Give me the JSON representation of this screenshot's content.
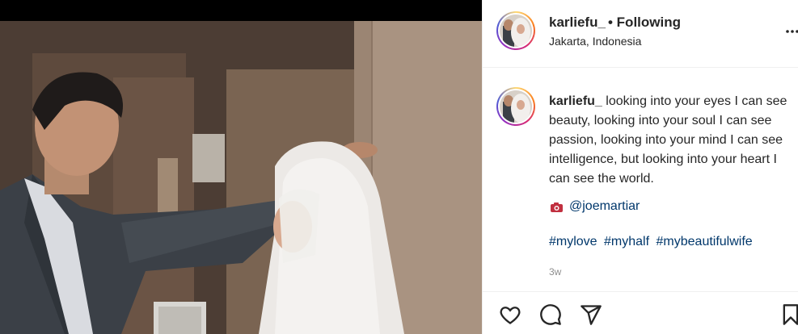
{
  "post": {
    "username": "karliefu_",
    "follow_status": "• Following",
    "location": "Jakarta, Indonesia",
    "caption_user": "karliefu_",
    "caption": "looking into your eyes I can see beauty, looking into your soul I can see passion, looking into your mind I can see intelligence, but looking into your heart I can see the world.",
    "photo_credit": "@joemartiar",
    "hashtags": [
      "#mylove",
      "#myhalf",
      "#mybeautifulwife"
    ],
    "time_ago": "3w"
  },
  "icons": {
    "more": "more-options-icon",
    "camera": "camera-icon",
    "like": "heart-icon",
    "comment": "comment-icon",
    "share": "share-icon",
    "save": "bookmark-icon"
  },
  "colors": {
    "text": "#262626",
    "link": "#00376b",
    "muted": "#8e8e8e",
    "divider": "#efefef"
  }
}
